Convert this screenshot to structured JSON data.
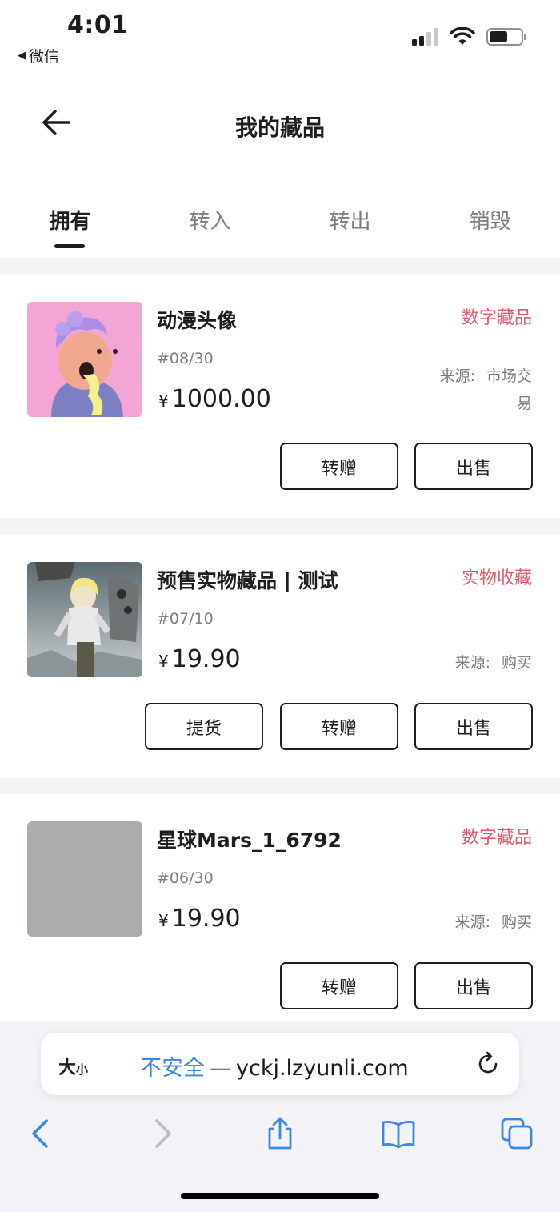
{
  "status_bar": {
    "time": "4:01",
    "back_app": "微信",
    "back_icon": "back-triangle-icon",
    "icons": [
      "cellular-signal-icon",
      "wifi-icon",
      "battery-icon"
    ]
  },
  "nav": {
    "title": "我的藏品",
    "back_icon": "arrow-left-icon"
  },
  "tabs": [
    {
      "label": "拥有",
      "active": true
    },
    {
      "label": "转入",
      "active": false
    },
    {
      "label": "转出",
      "active": false
    },
    {
      "label": "销毁",
      "active": false
    }
  ],
  "items": [
    {
      "name": "动漫头像",
      "tag": "数字藏品",
      "serial": "#08/30",
      "currency": "¥",
      "price": "1000.00",
      "source_label": "来源:",
      "source_line1": "市场交",
      "source_line2": "易",
      "buttons": [
        "转赠",
        "出售"
      ]
    },
    {
      "name": "预售实物藏品 | 测试",
      "tag": "实物收藏",
      "serial": "#07/10",
      "currency": "¥",
      "price": "19.90",
      "source_label": "来源:",
      "source_value": "购买",
      "buttons": [
        "提货",
        "转赠",
        "出售"
      ]
    },
    {
      "name": "星球Mars_1_6792",
      "tag": "数字藏品",
      "serial": "#06/30",
      "currency": "¥",
      "price": "19.90",
      "source_label": "来源:",
      "source_value": "购买",
      "buttons": [
        "转赠",
        "出售"
      ]
    }
  ],
  "browser": {
    "text_size_big": "大",
    "text_size_small": "小",
    "security": "不安全",
    "separator": "—",
    "domain": "yckj.lzyunli.com",
    "reload_icon": "reload-icon",
    "toolbar_icons": [
      "back-chevron-icon",
      "forward-chevron-icon",
      "share-icon",
      "bookmarks-icon",
      "tabs-icon"
    ]
  },
  "colors": {
    "tag": "#e05a6a",
    "link": "#3a86e4",
    "background": "#f4f4f5"
  }
}
